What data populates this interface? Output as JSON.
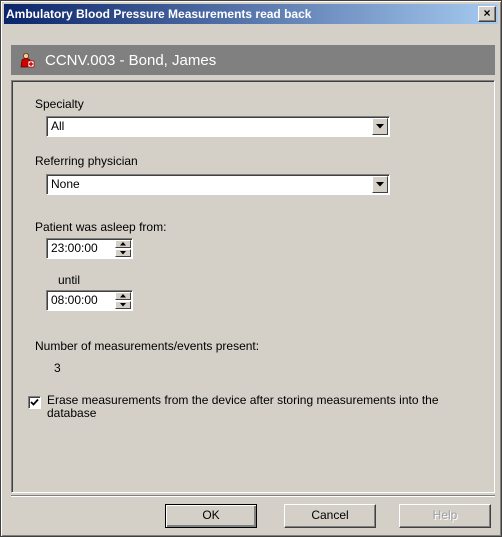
{
  "window": {
    "title": "Ambulatory Blood Pressure Measurements read back",
    "close_label": "×"
  },
  "patient": {
    "header": "CCNV.003 - Bond, James",
    "icon": "patient-icon"
  },
  "form": {
    "specialty_label": "Specialty",
    "specialty_value": "All",
    "referring_label": "Referring physician",
    "referring_value": "None",
    "asleep_from_label": "Patient was asleep from:",
    "asleep_from_value": "23:00:00",
    "until_label": "until",
    "until_value": "08:00:00",
    "measurements_label": "Number of measurements/events present:",
    "measurements_value": "3",
    "erase_checked": true,
    "erase_label": "Erase measurements from the device after storing measurements into the database"
  },
  "buttons": {
    "ok": "OK",
    "cancel": "Cancel",
    "help": "Help"
  },
  "colors": {
    "dialog_bg": "#d4d0c8",
    "titlebar_start": "#0a246a",
    "titlebar_end": "#a6caf0",
    "patient_bar": "#808080"
  }
}
